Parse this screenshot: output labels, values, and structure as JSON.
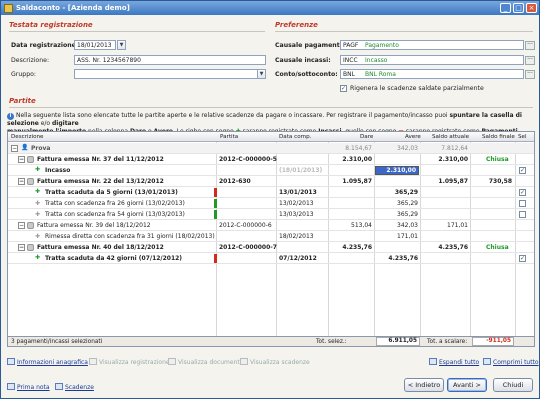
{
  "window": {
    "title": "Saldaconto - [Azienda demo]"
  },
  "registration": {
    "section_title": "Testata registrazione",
    "date_label": "Data registrazione:",
    "date_value": "18/01/2013",
    "description_label": "Descrizione:",
    "description_value": "ASS. Nr. 1234567890",
    "group_label": "Gruppo:",
    "group_value": ""
  },
  "preferences": {
    "section_title": "Preferenze",
    "payments_label": "Causale pagamenti:",
    "payments_code": "PAGF",
    "payments_name": "Pagamento",
    "collections_label": "Causale incassi:",
    "collections_code": "INCC",
    "collections_name": "Incasso",
    "account_label": "Conto/sottoconto:",
    "account_code": "BNL",
    "account_name": "BNL Roma",
    "regenerate_label": "Rigenera le scadenze saldate parzialmente",
    "regenerate_checked": true
  },
  "partite": {
    "section_title": "Partite",
    "info_line1_a": "Nella seguente lista sono elencate tutte le partite aperte e le relative scadenze da pagare o incassare. Per registrare il pagamento/incasso puoi ",
    "info_line1_b": "spuntare la casella di selezione",
    "info_line1_c": " e/o ",
    "info_line1_d": "digitare",
    "info_line2_a": "manualmente l'importo",
    "info_line2_b": " nella colonna ",
    "info_line2_c": "Dare",
    "info_line2_d": " o ",
    "info_line2_e": "Avere",
    "info_line2_f": ". Le righe con segno ",
    "info_line2_g": " saranno registrate come ",
    "info_line2_h": "Incassi",
    "info_line2_i": ", quelle con segno ",
    "info_line2_j": " saranno registrate come ",
    "info_line2_k": "Pagamenti"
  },
  "grid": {
    "columns": {
      "descrizione": "Descrizione",
      "partita": "Partita",
      "data_comp": "Data comp.",
      "dare": "Dare",
      "avere": "Avere",
      "saldo_attuale": "Saldo attuale",
      "saldo_finale": "Saldo finale",
      "sel": "Sel"
    },
    "rows": [
      {
        "desc": "Prova",
        "partita": "",
        "data": "",
        "dare": "8.154,67",
        "avere": "342,03",
        "saldo_att": "7.812,64",
        "saldo_fin": "",
        "chiusa": ""
      },
      {
        "desc": "Fattura emessa Nr. 37 del 11/12/2012",
        "partita": "2012-C-000000-5",
        "data": "",
        "dare": "2.310,00",
        "avere": "",
        "saldo_att": "2.310,00",
        "saldo_fin": "",
        "chiusa": "Chiusa"
      },
      {
        "desc": "Incasso",
        "partita": "",
        "data": "(18/01/2013)",
        "dare": "",
        "avere": "2.310,00",
        "saldo_att": "",
        "saldo_fin": "",
        "chiusa": ""
      },
      {
        "desc": "Fattura emessa Nr. 22 del 13/12/2012",
        "partita": "2012-630",
        "data": "",
        "dare": "1.095,87",
        "avere": "",
        "saldo_att": "1.095,87",
        "saldo_fin": "730,58",
        "chiusa": ""
      },
      {
        "desc": "Tratta scaduta da 5 giorni (13/01/2013)",
        "partita": "",
        "data": "13/01/2013",
        "dare": "",
        "avere": "365,29",
        "saldo_att": "",
        "saldo_fin": "",
        "chiusa": ""
      },
      {
        "desc": "Tratta con scadenza fra 26 giorni (13/02/2013)",
        "partita": "",
        "data": "13/02/2013",
        "dare": "",
        "avere": "365,29",
        "saldo_att": "",
        "saldo_fin": "",
        "chiusa": ""
      },
      {
        "desc": "Tratta con scadenza fra 54 giorni (13/03/2013)",
        "partita": "",
        "data": "13/03/2013",
        "dare": "",
        "avere": "365,29",
        "saldo_att": "",
        "saldo_fin": "",
        "chiusa": ""
      },
      {
        "desc": "Fattura emessa Nr. 39 del 18/12/2012",
        "partita": "2012-C-000000-6",
        "data": "",
        "dare": "513,04",
        "avere": "342,03",
        "saldo_att": "171,01",
        "saldo_fin": "",
        "chiusa": ""
      },
      {
        "desc": "Rimessa diretta con scadenza fra 31 giorni (18/02/2013)",
        "partita": "",
        "data": "18/02/2013",
        "dare": "",
        "avere": "171,01",
        "saldo_att": "",
        "saldo_fin": "",
        "chiusa": ""
      },
      {
        "desc": "Fattura emessa Nr. 40 del 18/12/2012",
        "partita": "2012-C-000000-7",
        "data": "",
        "dare": "4.235,76",
        "avere": "",
        "saldo_att": "4.235,76",
        "saldo_fin": "",
        "chiusa": "Chiusa"
      },
      {
        "desc": "Tratta scaduta da 42 giorni (07/12/2012)",
        "partita": "",
        "data": "07/12/2012",
        "dare": "",
        "avere": "4.235,76",
        "saldo_att": "",
        "saldo_fin": "",
        "chiusa": ""
      }
    ],
    "footer": {
      "selected": "3 pagamenti/incassi selezionati",
      "tot_sel_label": "Tot. selez.:",
      "tot_sel_value": "6.911,05",
      "tot_scalare_label": "Tot. a scalare:",
      "tot_scalare_value": "-911,05"
    }
  },
  "links": {
    "info_anagrafica": "Informazioni anagrafica",
    "vis_registrazione": "Visualizza registrazione",
    "vis_documento": "Visualizza documento",
    "vis_scadenze": "Visualizza scadenze",
    "espandi": "Espandi tutto",
    "comprimi": "Comprimi tutto",
    "prima_nota": "Prima nota",
    "scadenze": "Scadenze"
  },
  "buttons": {
    "back": "< Indietro",
    "next": "Avanti >",
    "close": "Chiudi"
  }
}
